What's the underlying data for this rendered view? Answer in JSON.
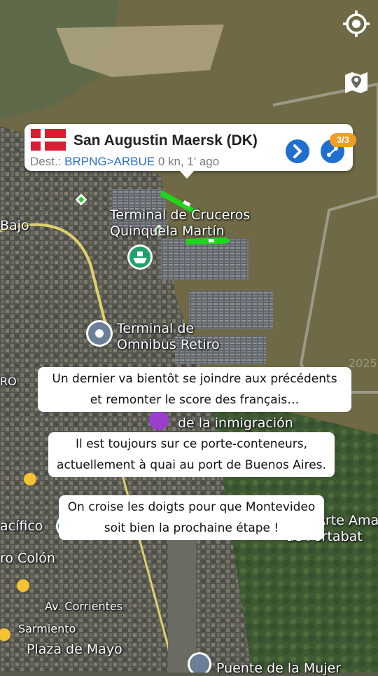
{
  "map": {
    "labels": {
      "bajo": "Bajo",
      "terminal_cruceros_1": "Terminal de Cruceros",
      "terminal_cruceros_2": "Quinquela Martín",
      "terminal_omnibus_1": "Terminal de",
      "terminal_omnibus_2": "Omnibus Retiro",
      "ro": "RO",
      "inmigracion": "de la inmigración",
      "pacifico": "acífico",
      "colon": "ro Colón",
      "corrientes": "Av. Corrientes",
      "sarmiento": "Sarmiento",
      "plaza_de_mayo": "Plaza de Mayo",
      "puente_mujer": "Puente de la Mujer",
      "arte_ama": "Arte Ama",
      "fortabat": "de Fortabat",
      "watermark": "2025"
    },
    "colors": {
      "water": "#6f6a45",
      "land": "#5d5e55",
      "vessel": "#1fd61f"
    }
  },
  "controls": {
    "locate_icon": "crosshair-icon",
    "layers_icon": "map-pin-icon"
  },
  "vessel_card": {
    "name": "San Augustin Maersk (DK)",
    "dest_label": "Dest.:",
    "dest_code": "BRPNG>ARBUE",
    "speed_time": "0 kn, 1' ago",
    "count": "3/3",
    "flag": "Denmark",
    "colors": {
      "accent": "#1f6fd1",
      "badge": "#f29b25"
    }
  },
  "captions": [
    {
      "line1": "Un dernier va bientôt se joindre aux précédents",
      "line2": "et remonter le score des français…"
    },
    {
      "line1": "Il est toujours sur ce porte-conteneurs,",
      "line2": "actuellement à quai au port de Buenos Aires."
    },
    {
      "line1": "On croise les doigts pour que Montevideo",
      "line2": "soit bien la prochaine étape !"
    }
  ]
}
